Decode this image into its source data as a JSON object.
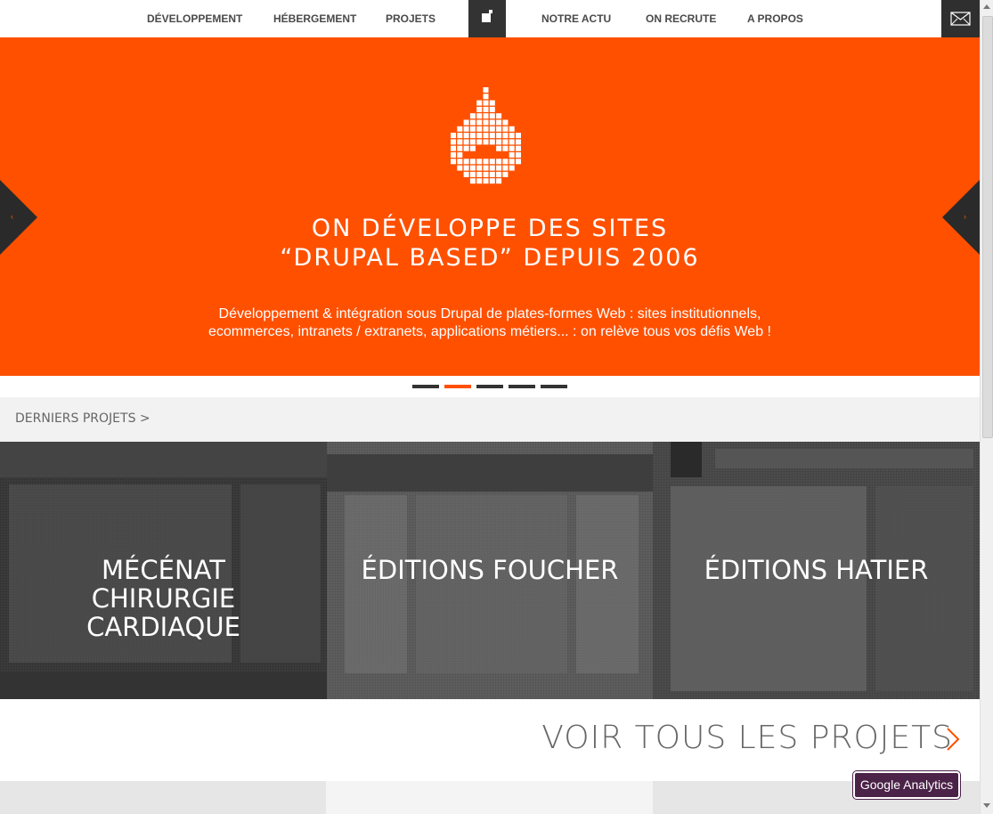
{
  "nav": {
    "items": [
      {
        "label": "DÉVELOPPEMENT"
      },
      {
        "label": "HÉBERGEMENT"
      },
      {
        "label": "PROJETS"
      },
      {
        "label": "NOTRE ACTU"
      },
      {
        "label": "ON RECRUTE"
      },
      {
        "label": "A PROPOS"
      }
    ]
  },
  "hero": {
    "title_line1": "ON DÉVELOPPE DES SITES",
    "title_line2": "“DRUPAL BASED” DEPUIS 2006",
    "description_line1": "Développement & intégration sous Drupal de plates-formes Web : sites institutionnels,",
    "description_line2": "ecommerces, intranets / extranets, applications métiers... : on relève tous vos défis Web !",
    "arrow_left": "‹",
    "arrow_right": "›",
    "active_slide": 2,
    "slide_count": 5
  },
  "projects": {
    "section_title": "DERNIERS PROJETS >",
    "tiles": [
      {
        "label_lines": [
          "MÉCÉNAT",
          "CHIRURGIE",
          "CARDIAQUE"
        ]
      },
      {
        "label_lines": [
          "ÉDITIONS FOUCHER"
        ]
      },
      {
        "label_lines": [
          "ÉDITIONS HATIER"
        ]
      }
    ],
    "see_all": "VOIR TOUS LES PROJETS"
  },
  "widgets": {
    "google_analytics": "Google Analytics"
  },
  "colors": {
    "brand_orange": "#ff5000",
    "dark": "#333333",
    "analytics_purple": "#4b2248"
  },
  "icons": {
    "logo": "drupal-drop-logo",
    "mail": "envelope-icon",
    "prev": "chevron-left-icon",
    "next": "chevron-right-icon"
  }
}
